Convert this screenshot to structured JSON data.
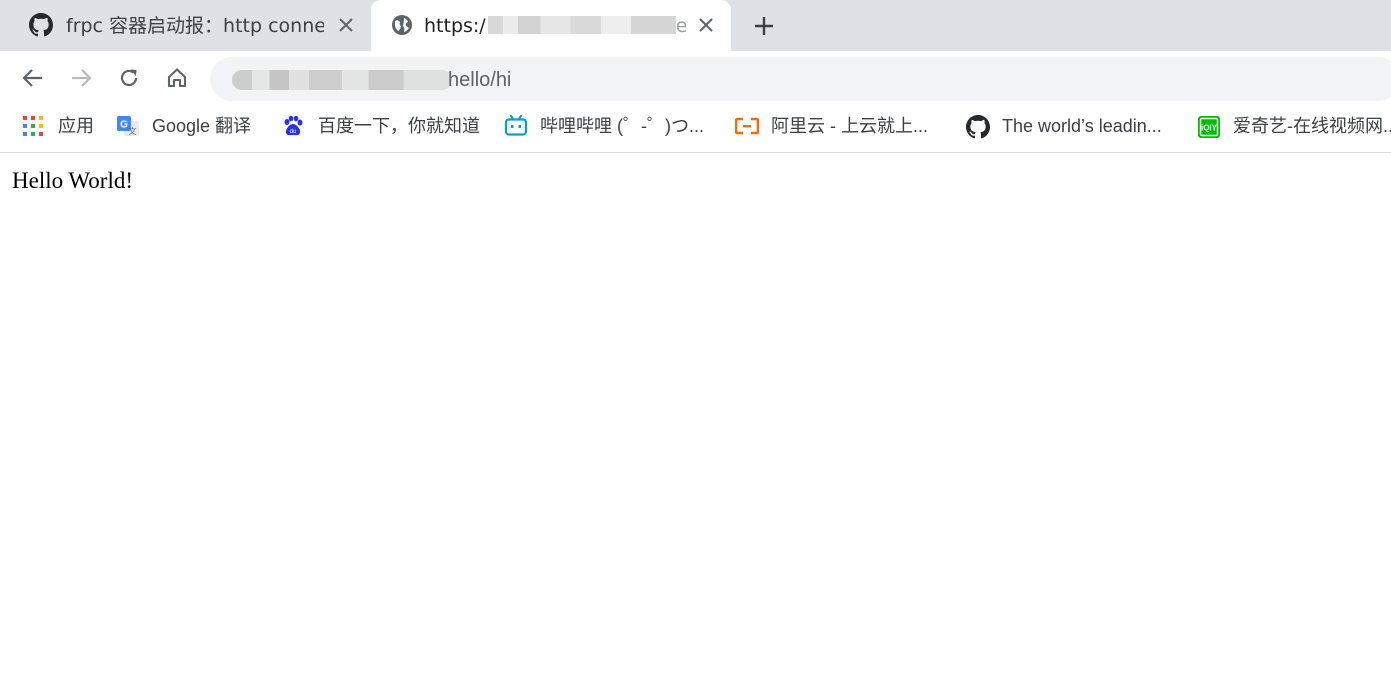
{
  "tabs": [
    {
      "title": "frpc 容器启动报：http connect",
      "favicon": "github-icon",
      "active": false
    },
    {
      "title_prefix": "https:/",
      "title_suffix": "ello",
      "favicon": "globe-icon",
      "active": true
    }
  ],
  "toolbar": {
    "back": "back-icon",
    "forward": "forward-icon",
    "reload": "reload-icon",
    "home": "home-icon"
  },
  "omnibox": {
    "url_visible": "hello/hi"
  },
  "bookmarks": [
    {
      "label": "应用",
      "icon": "apps-grid-icon"
    },
    {
      "label": "Google 翻译",
      "icon": "google-translate-icon"
    },
    {
      "label": "百度一下，你就知道",
      "icon": "baidu-icon"
    },
    {
      "label": "哔哩哔哩 (゜-゜)つ...",
      "icon": "bilibili-icon"
    },
    {
      "label": "阿里云 - 上云就上...",
      "icon": "aliyun-icon"
    },
    {
      "label": "The world’s leadin...",
      "icon": "github-icon"
    },
    {
      "label": "爱奇艺-在线视频网...",
      "icon": "iqiyi-icon"
    }
  ],
  "page": {
    "text": "Hello World!"
  },
  "colors": {
    "tabstrip": "#dee1e6",
    "omnibox": "#f1f3f4",
    "bilibili": "#00a1d6",
    "aliyun": "#ff6a00",
    "iqiyi": "#00be06",
    "baidu": "#2932e1"
  }
}
